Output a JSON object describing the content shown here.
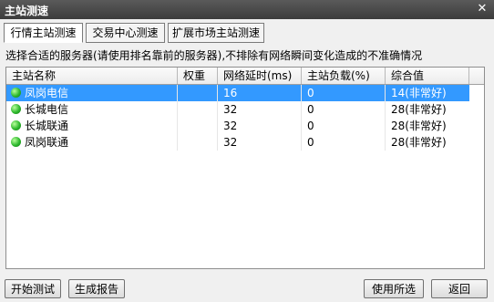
{
  "window": {
    "title": "主站测速",
    "close_label": "✕"
  },
  "tabs": [
    {
      "label": "行情主站测速",
      "active": true
    },
    {
      "label": "交易中心测速",
      "active": false
    },
    {
      "label": "扩展市场主站测速",
      "active": false
    }
  ],
  "hint": "选择合适的服务器(请使用排名靠前的服务器),不排除有网络瞬间变化造成的不准确情况",
  "table": {
    "columns": [
      "主站名称",
      "权重",
      "网络延时(ms)",
      "主站负载(%)",
      "综合值"
    ],
    "rows": [
      {
        "name": "凤岗电信",
        "weight": "",
        "latency": "16",
        "load": "0",
        "score": "14(非常好)",
        "selected": true
      },
      {
        "name": "长城电信",
        "weight": "",
        "latency": "32",
        "load": "0",
        "score": "28(非常好)",
        "selected": false
      },
      {
        "name": "长城联通",
        "weight": "",
        "latency": "32",
        "load": "0",
        "score": "28(非常好)",
        "selected": false
      },
      {
        "name": "凤岗联通",
        "weight": "",
        "latency": "32",
        "load": "0",
        "score": "28(非常好)",
        "selected": false
      }
    ]
  },
  "buttons": {
    "start": "开始测试",
    "report": "生成报告",
    "use_selected": "使用所选",
    "back": "返回"
  },
  "colors": {
    "selection": "#3399ff",
    "status_good": "#2db82d"
  }
}
